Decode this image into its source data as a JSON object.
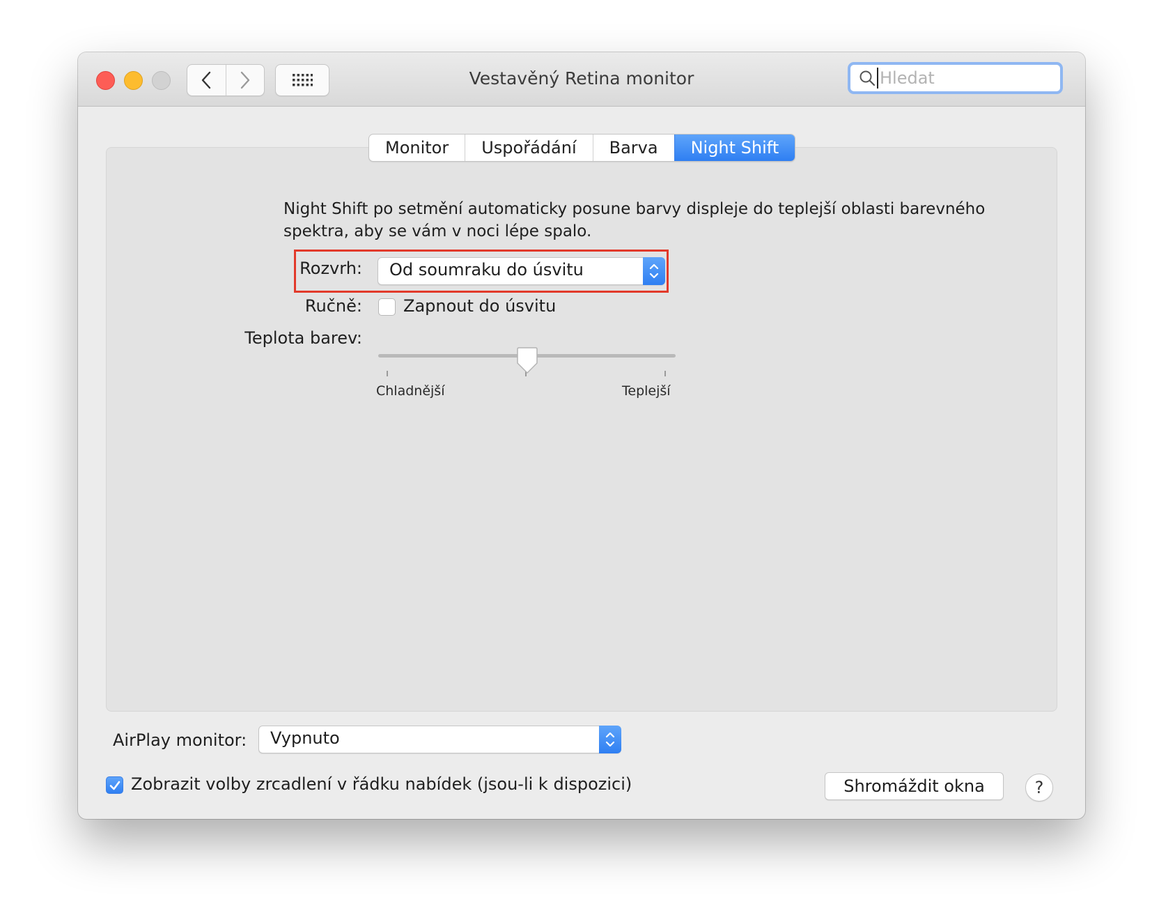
{
  "window": {
    "title": "Vestavěný Retina monitor",
    "search_placeholder": "Hledat"
  },
  "toolbar": {
    "back_icon": "chevron-left-icon",
    "forward_icon": "chevron-right-icon",
    "grid_icon": "grid-icon"
  },
  "tabs": [
    {
      "label": "Monitor",
      "active": false
    },
    {
      "label": "Uspořádání",
      "active": false
    },
    {
      "label": "Barva",
      "active": false
    },
    {
      "label": "Night Shift",
      "active": true
    }
  ],
  "night_shift": {
    "description_line1": "Night Shift po setmění automaticky posune barvy displeje do teplejší oblasti barevného",
    "description_line2": "spektra, aby se vám v noci lépe spalo.",
    "schedule_label": "Rozvrh:",
    "schedule_value": "Od soumraku do úsvitu",
    "manual_label": "Ručně:",
    "manual_checkbox_label": "Zapnout do úsvitu",
    "manual_checked": false,
    "temperature_label": "Teplota barev:",
    "temperature_min_label": "Chladnější",
    "temperature_max_label": "Teplejší",
    "temperature_level": 0.5
  },
  "footer": {
    "airplay_label": "AirPlay monitor:",
    "airplay_value": "Vypnuto",
    "mirror_checkbox_label": "Zobrazit volby zrcadlení v řádku nabídek (jsou-li k dispozici)",
    "mirror_checked": true,
    "gather_button": "Shromáždit okna",
    "help_button": "?"
  },
  "colors": {
    "accent": "#3a86f5",
    "highlight_box": "#e23a2b",
    "close": "#fd5d56",
    "minimize": "#fdbc2e",
    "zoom": "#d2d2d2"
  }
}
